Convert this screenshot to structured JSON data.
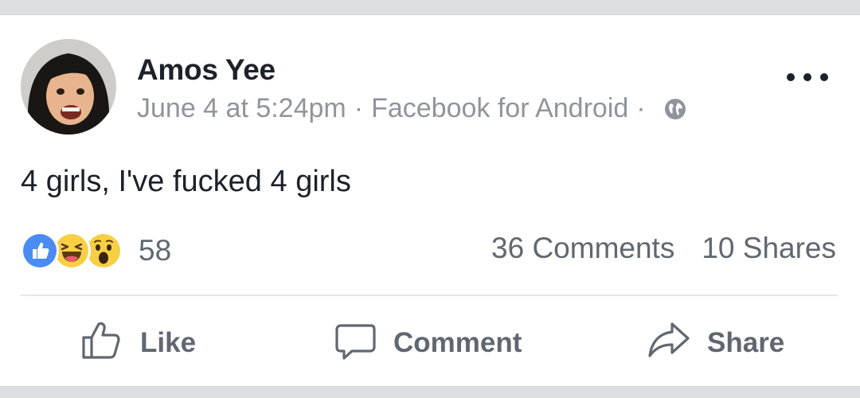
{
  "post": {
    "author": "Amos Yee",
    "date": "June 4 at 5:24pm",
    "separator": "·",
    "source": "Facebook for Android",
    "visibility_icon": "globe-icon",
    "text": "4 girls, I've fucked 4 girls"
  },
  "reactions": {
    "types": [
      "like",
      "haha",
      "wow"
    ],
    "count": "58"
  },
  "stats": {
    "comments": "36 Comments",
    "shares": "10 Shares"
  },
  "actions": {
    "like": "Like",
    "comment": "Comment",
    "share": "Share"
  },
  "colors": {
    "like_blue": "#4a8cf1",
    "emoji_yellow": "#f7cf45",
    "text_dark": "#1d2129",
    "text_muted": "#90949c",
    "action_gray": "#616770"
  }
}
